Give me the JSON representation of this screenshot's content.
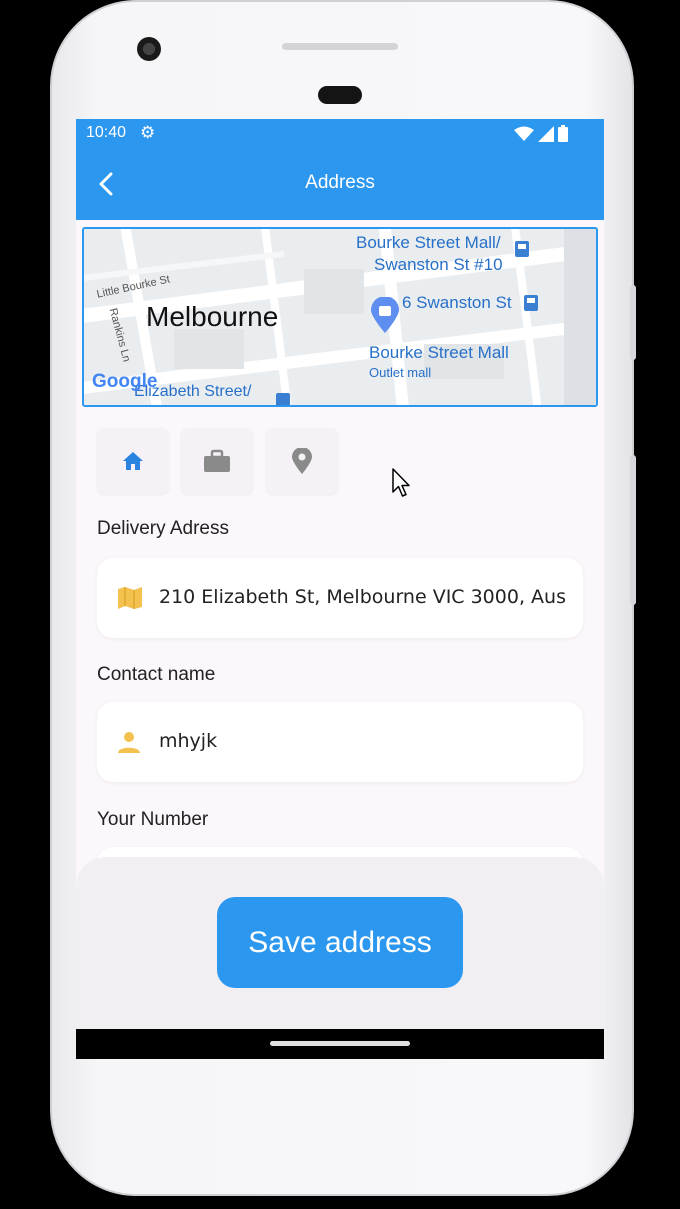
{
  "status": {
    "time": "10:40"
  },
  "header": {
    "title": "Address"
  },
  "map": {
    "city": "Melbourne",
    "streets": [
      "Little Bourke St",
      "Rankins Ln",
      "Elizabeth Street/"
    ],
    "pois": [
      {
        "line1": "Bourke Street Mall/",
        "line2": "Swanston St #10"
      },
      {
        "line1": "6 Swanston St"
      },
      {
        "line1": "Bourke Street Mall",
        "line2": "Outlet mall"
      }
    ],
    "logo": "Google"
  },
  "address_types": [
    "home-icon",
    "briefcase-icon",
    "location-pin-icon"
  ],
  "form": {
    "delivery": {
      "label": "Delivery Adress",
      "value": "210 Elizabeth St, Melbourne VIC 3000, Aus",
      "icon": "map-icon"
    },
    "contact": {
      "label": "Contact name",
      "value": "mhyjk",
      "icon": "person-icon"
    },
    "number": {
      "label": "Your Number"
    }
  },
  "save_button": {
    "label": "Save address"
  },
  "colors": {
    "primary": "#2b97ee",
    "accent_icon": "#f2c14e",
    "background": "#fbf7fb"
  }
}
